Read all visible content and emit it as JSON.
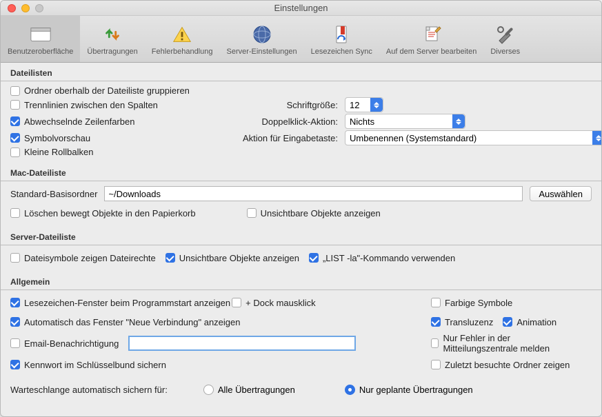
{
  "window": {
    "title": "Einstellungen"
  },
  "toolbar": {
    "items": [
      {
        "label": "Benutzeroberfläche"
      },
      {
        "label": "Übertragungen"
      },
      {
        "label": "Fehlerbehandlung"
      },
      {
        "label": "Server-Einstellungen"
      },
      {
        "label": "Lesezeichen Sync"
      },
      {
        "label": "Auf dem Server bearbeiten"
      },
      {
        "label": "Diverses"
      }
    ]
  },
  "sections": {
    "filelists": {
      "title": "Dateilisten",
      "group_folders": "Ordner oberhalb der Dateiliste gruppieren",
      "separators": "Trennlinien zwischen den Spalten",
      "alt_rows": "Abwechselnde Zeilenfarben",
      "icon_preview": "Symbolvorschau",
      "small_scrollbars": "Kleine Rollbalken",
      "font_size_label": "Schriftgröße:",
      "font_size_value": "12",
      "dblclick_label": "Doppelklick-Aktion:",
      "dblclick_value": "Nichts",
      "enter_label": "Aktion für Eingabetaste:",
      "enter_value": "Umbenennen (Systemstandard)"
    },
    "mac": {
      "title": "Mac-Dateiliste",
      "basefolder_label": "Standard-Basisordner",
      "basefolder_value": "~/Downloads",
      "choose": "Auswählen",
      "trash": "Löschen bewegt Objekte in den Papierkorb",
      "invisible": "Unsichtbare Objekte anzeigen"
    },
    "server": {
      "title": "Server-Dateiliste",
      "icons_rights": "Dateisymbole zeigen Dateirechte",
      "invisible": "Unsichtbare Objekte anzeigen",
      "list_la": "„LIST -la\"-Kommando verwenden"
    },
    "general": {
      "title": "Allgemein",
      "bookmarks": "Lesezeichen-Fenster beim Programmstart anzeigen",
      "dock": "+ Dock mausklick",
      "newconn": "Automatisch das Fenster \"Neue Verbindung\" anzeigen",
      "email": "Email-Benachrichtigung",
      "keychain": "Kennwort im Schlüsselbund sichern",
      "coloricons": "Farbige Symbole",
      "translucency": "Transluzenz",
      "animation": "Animation",
      "errors_only": "Nur Fehler in der Mitteilungszentrale melden",
      "recent_folders": "Zuletzt besuchte Ordner zeigen",
      "queue_label": "Warteschlange automatisch sichern für:",
      "queue_all": "Alle Übertragungen",
      "queue_planned": "Nur geplante Übertragungen"
    }
  }
}
